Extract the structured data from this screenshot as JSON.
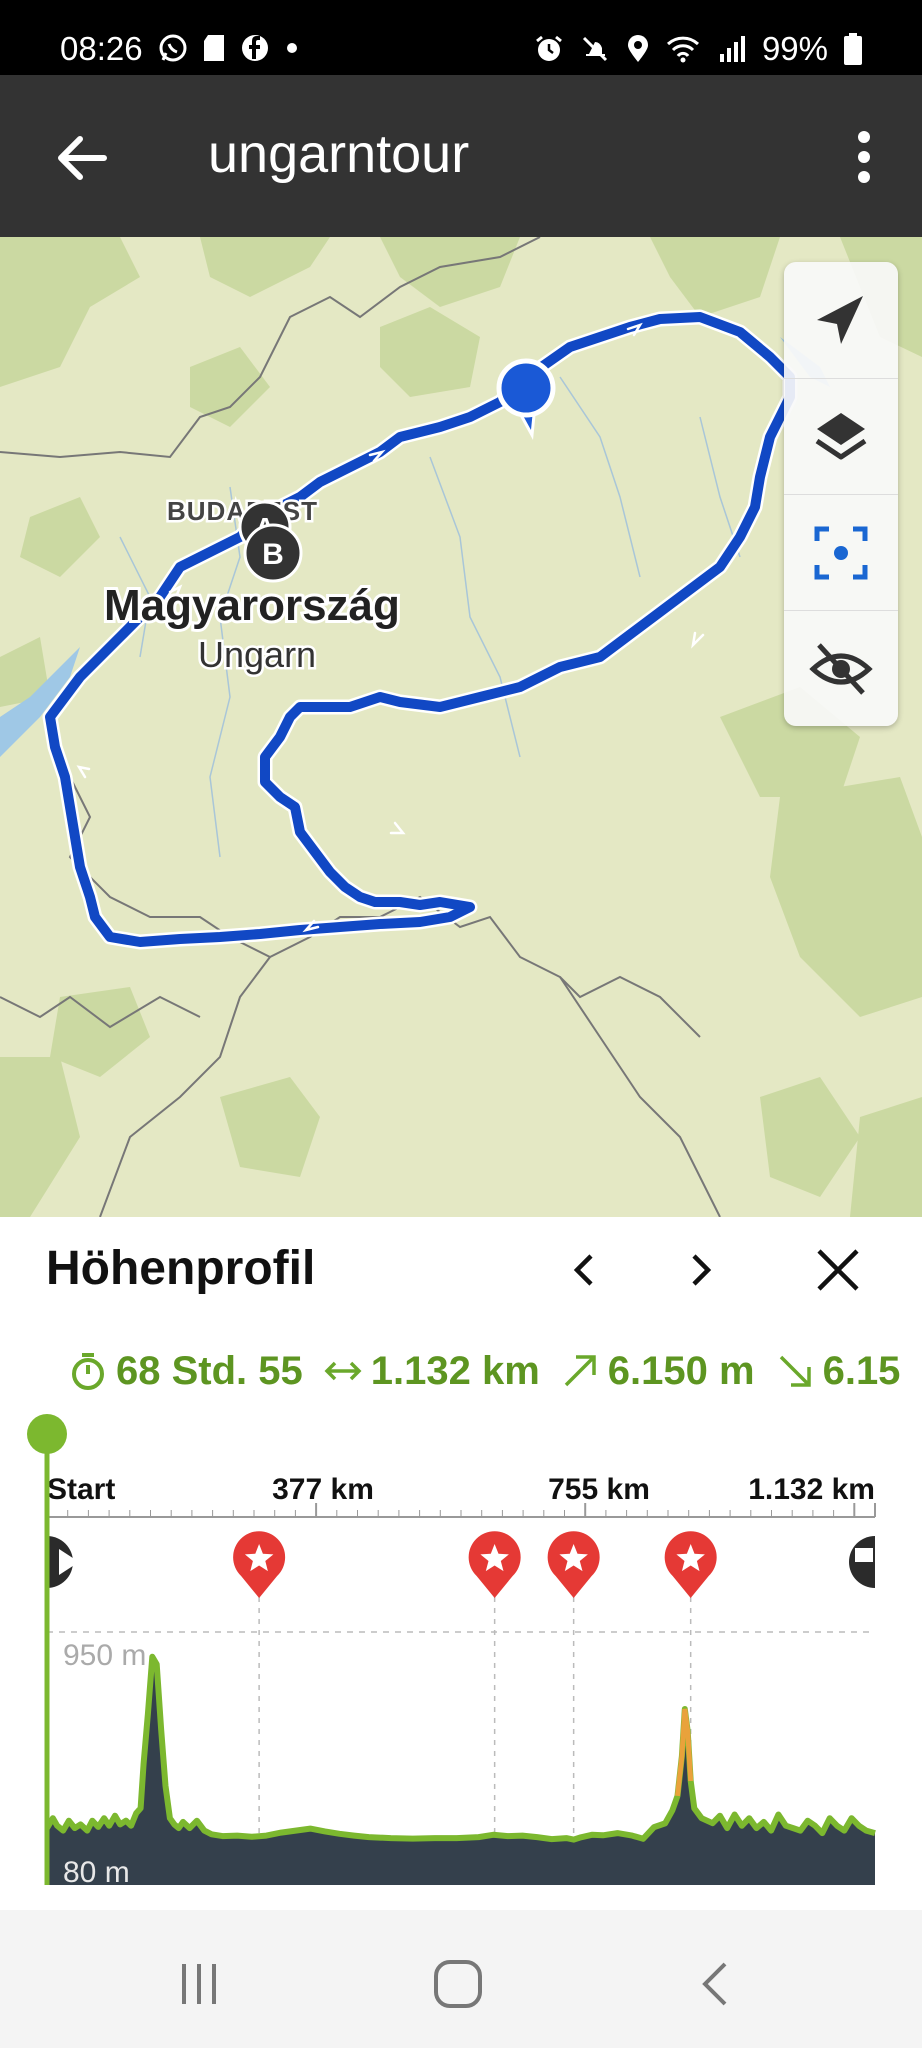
{
  "status": {
    "time": "08:26",
    "battery": "99%",
    "left_icons": [
      "whatsapp-icon",
      "sd-card-icon",
      "facebook-icon",
      "dot-icon"
    ],
    "right_icons": [
      "alarm-icon",
      "mute-icon",
      "location-icon",
      "wifi-icon",
      "signal-icon",
      "battery-icon"
    ]
  },
  "app_bar": {
    "title": "ungarntour",
    "back_icon": "arrow-left-icon",
    "menu_icon": "more-vert-icon"
  },
  "map": {
    "label_city": "BUDAPEST",
    "label_country": "Magyarország",
    "label_country_de": "Ungarn",
    "marker_a": "A",
    "marker_b": "B",
    "route_color": "#0f4fc8",
    "controls": [
      "navigation-arrow-icon",
      "layers-icon",
      "center-focus-icon",
      "visibility-off-icon"
    ]
  },
  "panel": {
    "title": "Höhenprofil",
    "prev_icon": "chevron-left-icon",
    "next_icon": "chevron-right-icon",
    "close_icon": "close-icon",
    "stats": {
      "duration": "68 Std. 55",
      "distance": "1.132 km",
      "ascent": "6.150 m",
      "descent": "6.15"
    }
  },
  "chart_data": {
    "type": "area",
    "x_tick_labels": [
      "Start",
      "377 km",
      "755 km",
      "1.132 km"
    ],
    "y_tick_labels": [
      "950 m",
      "80 m"
    ],
    "xlim": [
      0,
      1132
    ],
    "ylim": [
      80,
      950
    ],
    "waypoint_markers": {
      "start": 0,
      "stars": [
        290,
        612,
        720,
        880
      ],
      "finish": 1132
    },
    "series": [
      {
        "values": [
          [
            0,
            160
          ],
          [
            8,
            200
          ],
          [
            14,
            170
          ],
          [
            22,
            150
          ],
          [
            30,
            190
          ],
          [
            38,
            160
          ],
          [
            46,
            175
          ],
          [
            55,
            150
          ],
          [
            62,
            190
          ],
          [
            70,
            165
          ],
          [
            78,
            200
          ],
          [
            85,
            170
          ],
          [
            93,
            210
          ],
          [
            100,
            175
          ],
          [
            108,
            190
          ],
          [
            115,
            170
          ],
          [
            122,
            220
          ],
          [
            128,
            240
          ],
          [
            132,
            420
          ],
          [
            138,
            620
          ],
          [
            144,
            850
          ],
          [
            150,
            820
          ],
          [
            156,
            560
          ],
          [
            162,
            330
          ],
          [
            168,
            200
          ],
          [
            174,
            175
          ],
          [
            180,
            160
          ],
          [
            186,
            185
          ],
          [
            195,
            160
          ],
          [
            205,
            190
          ],
          [
            215,
            150
          ],
          [
            225,
            135
          ],
          [
            240,
            128
          ],
          [
            260,
            130
          ],
          [
            280,
            125
          ],
          [
            300,
            130
          ],
          [
            320,
            142
          ],
          [
            340,
            150
          ],
          [
            360,
            158
          ],
          [
            380,
            147
          ],
          [
            400,
            137
          ],
          [
            420,
            130
          ],
          [
            440,
            124
          ],
          [
            470,
            120
          ],
          [
            500,
            118
          ],
          [
            530,
            120
          ],
          [
            560,
            120
          ],
          [
            590,
            124
          ],
          [
            610,
            133
          ],
          [
            630,
            128
          ],
          [
            650,
            130
          ],
          [
            670,
            124
          ],
          [
            690,
            116
          ],
          [
            710,
            120
          ],
          [
            720,
            114
          ],
          [
            730,
            123
          ],
          [
            745,
            133
          ],
          [
            760,
            131
          ],
          [
            780,
            140
          ],
          [
            800,
            130
          ],
          [
            815,
            117
          ],
          [
            830,
            164
          ],
          [
            845,
            179
          ],
          [
            855,
            232
          ],
          [
            862,
            290
          ],
          [
            868,
            450
          ],
          [
            872,
            640
          ],
          [
            876,
            550
          ],
          [
            880,
            350
          ],
          [
            885,
            240
          ],
          [
            895,
            200
          ],
          [
            910,
            180
          ],
          [
            920,
            210
          ],
          [
            930,
            160
          ],
          [
            940,
            215
          ],
          [
            950,
            170
          ],
          [
            960,
            200
          ],
          [
            970,
            160
          ],
          [
            980,
            185
          ],
          [
            990,
            150
          ],
          [
            1000,
            215
          ],
          [
            1010,
            170
          ],
          [
            1020,
            160
          ],
          [
            1030,
            150
          ],
          [
            1040,
            190
          ],
          [
            1050,
            170
          ],
          [
            1060,
            140
          ],
          [
            1070,
            200
          ],
          [
            1080,
            170
          ],
          [
            1090,
            150
          ],
          [
            1100,
            200
          ],
          [
            1110,
            170
          ],
          [
            1120,
            150
          ],
          [
            1132,
            140
          ]
        ]
      }
    ],
    "grid": true
  },
  "sysnav": {
    "recent_icon": "recent-apps-icon",
    "home_icon": "home-icon",
    "back_icon": "system-back-icon"
  }
}
